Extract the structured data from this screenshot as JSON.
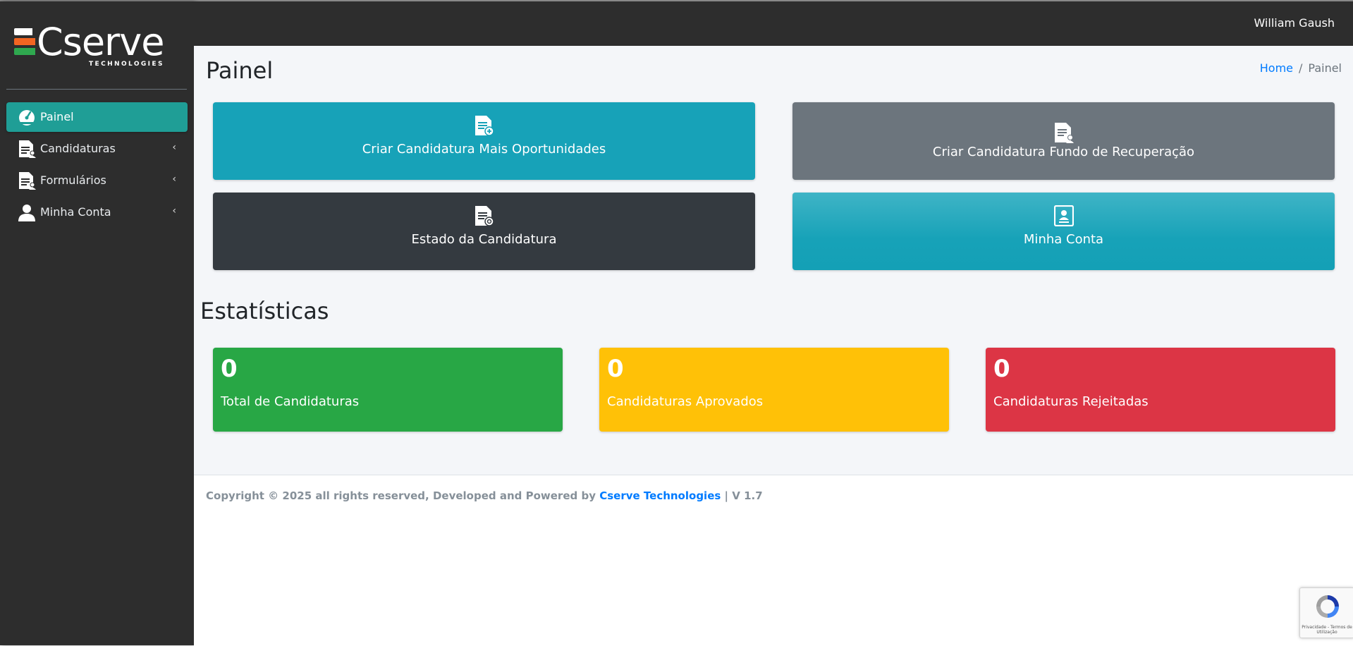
{
  "brand": {
    "name": "Cserve",
    "subtitle": "TECHNOLOGIES",
    "colors": [
      "#ffffff",
      "#f26522",
      "#2fa84f"
    ]
  },
  "sidebar": {
    "items": [
      {
        "label": "Painel",
        "icon": "dashboard-gauge-icon",
        "active": true,
        "chevron": ""
      },
      {
        "label": "Candidaturas",
        "icon": "document-user-icon",
        "active": false,
        "chevron": "‹"
      },
      {
        "label": "Formulários",
        "icon": "document-user-icon",
        "active": false,
        "chevron": "‹"
      },
      {
        "label": "Minha Conta",
        "icon": "user-icon",
        "active": false,
        "chevron": "‹"
      }
    ]
  },
  "topbar": {
    "user_name": "William Gaush"
  },
  "header": {
    "title": "Painel",
    "breadcrumb": {
      "home": "Home",
      "separator": "/",
      "current": "Painel"
    }
  },
  "tiles": [
    {
      "label": "Criar Candidatura Mais Oportunidades",
      "icon": "document-add-icon",
      "color": "#17a2b8"
    },
    {
      "label": "Criar Candidatura Fundo de Recuperação",
      "icon": "document-user-icon",
      "color": "#6c757d"
    },
    {
      "label": "Estado da Candidatura",
      "icon": "document-search-icon",
      "color": "#343a40"
    },
    {
      "label": "Minha Conta",
      "icon": "id-card-icon",
      "color": "#17a2b8"
    }
  ],
  "statistics": {
    "title": "Estatísticas",
    "cards": [
      {
        "value": "0",
        "label": "Total de Candidaturas",
        "color": "#28a745"
      },
      {
        "value": "0",
        "label": "Candidaturas Aprovados",
        "color": "#ffc107"
      },
      {
        "value": "0",
        "label": "Candidaturas Rejeitadas",
        "color": "#dc3545"
      }
    ]
  },
  "footer": {
    "prefix": "Copyright © 2025 all rights reserved, Developed and Powered by",
    "company": "Cserve Technologies",
    "version": "| V 1.7"
  },
  "recaptcha": {
    "text": "Privacidade - Termos de Utilização"
  }
}
